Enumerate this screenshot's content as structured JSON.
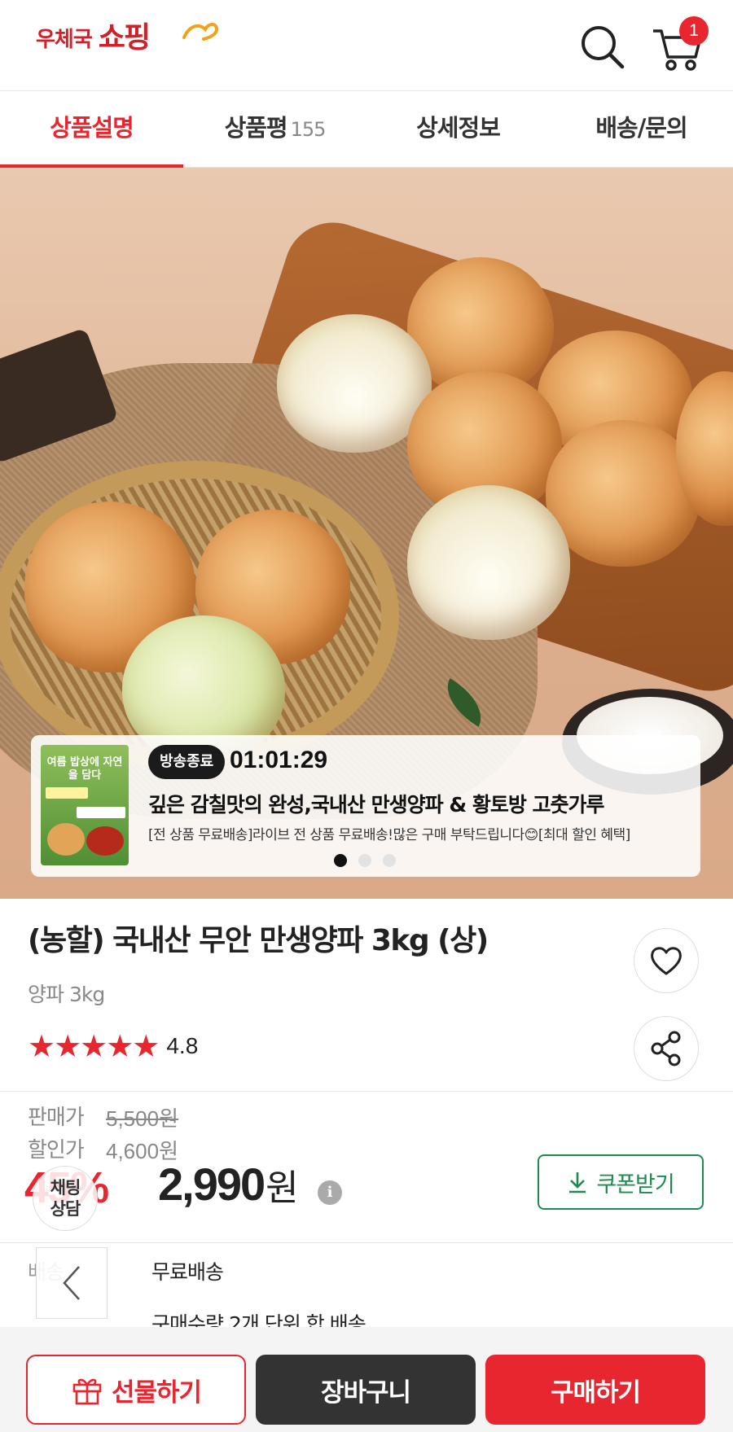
{
  "header": {
    "logo_small": "우체국",
    "logo_big": "쇼핑",
    "cart_count": "1",
    "search_icon": "search-icon",
    "cart_icon": "cart-icon"
  },
  "tabs": [
    {
      "label": "상품설명",
      "active": true
    },
    {
      "label": "상품평",
      "count": "155"
    },
    {
      "label": "상세정보"
    },
    {
      "label": "배송/문의"
    }
  ],
  "live": {
    "badge": "방송종료",
    "timer": "01:01:29",
    "title": "깊은 감칠맛의 완성,국내산 만생양파 & 황토방 고춧가루",
    "desc": "[전 상품 무료배송]라이브 전 상품 무료배송!많은 구매 부탁드립니다😊[최대 할인 혜택]",
    "thumb_text": "여름 밥상에 자연을 담다"
  },
  "product": {
    "title": "(농할) 국내산 무안 만생양파 3kg (상)",
    "subtitle": "양파 3kg",
    "stars": "★★★★★",
    "rating": "4.8"
  },
  "price": {
    "sale_label": "판매가",
    "sale_value": "5,500원",
    "discount_label": "할인가",
    "discount_value": "4,600원",
    "discount_rate": "45%",
    "final": "2,990",
    "final_unit": "원",
    "info_icon": "i",
    "coupon_label": "쿠폰받기"
  },
  "chat": {
    "line1": "채팅",
    "line2": "상담"
  },
  "shipping": {
    "label": "배송",
    "value": "무료배송",
    "note": "구매수량 2개 단위 합 배송"
  },
  "bottom": {
    "gift": "선물하기",
    "cart": "장바구니",
    "buy": "구매하기"
  },
  "colors": {
    "accent": "#e8262f",
    "coupon": "#1d8a4e",
    "dark": "#333333"
  }
}
